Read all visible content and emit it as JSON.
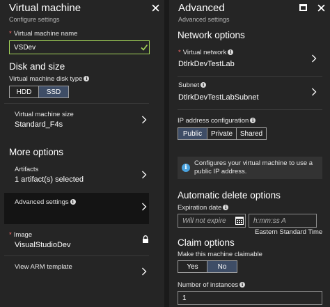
{
  "left": {
    "title": "Virtual machine",
    "subtitle": "Configure settings",
    "vm_name": {
      "label": "Virtual machine name",
      "value": "VSDev"
    },
    "disk_size_title": "Disk and size",
    "disk_type": {
      "label": "Virtual machine disk type",
      "options": [
        "HDD",
        "SSD"
      ],
      "selected": "SSD"
    },
    "vm_size": {
      "label": "Virtual machine size",
      "value": "Standard_F4s"
    },
    "more_options_title": "More options",
    "artifacts": {
      "label": "Artifacts",
      "value": "1 artifact(s) selected"
    },
    "advanced_settings": {
      "label": "Advanced settings"
    },
    "image": {
      "label": "Image",
      "value": "VisualStudioDev"
    },
    "arm_template": {
      "label": "View ARM template"
    }
  },
  "right": {
    "title": "Advanced",
    "subtitle": "Advanced settings",
    "network_title": "Network options",
    "virtual_network": {
      "label": "Virtual network",
      "value": "DtlrkDevTestLab"
    },
    "subnet": {
      "label": "Subnet",
      "value": "DtlrkDevTestLabSubnet"
    },
    "ip_config": {
      "label": "IP address configuration",
      "options": [
        "Public",
        "Private",
        "Shared"
      ],
      "selected": "Public"
    },
    "info_text": "Configures your virtual machine to use a public IP address.",
    "auto_delete_title": "Automatic delete options",
    "expiration": {
      "label": "Expiration date",
      "date_placeholder": "Will not expire",
      "time_placeholder": "h:mm:ss A",
      "timezone": "Eastern Standard Time"
    },
    "claim_title": "Claim options",
    "claimable": {
      "label": "Make this machine claimable",
      "options": [
        "Yes",
        "No"
      ],
      "selected": "No"
    },
    "instances": {
      "label": "Number of instances",
      "value": "1"
    }
  },
  "colors": {
    "accent_selected": "#3e4d66",
    "valid_green": "#a5d65a",
    "required_red": "#ff6b6b",
    "info_blue": "#4aa3df"
  }
}
